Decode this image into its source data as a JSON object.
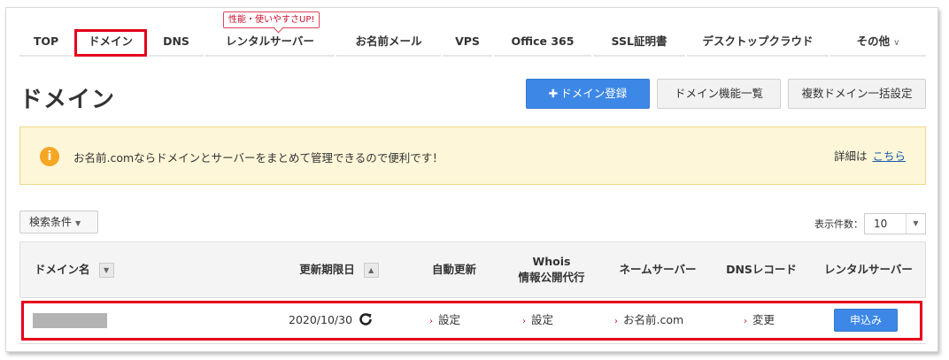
{
  "nav": {
    "items": [
      {
        "label": "TOP"
      },
      {
        "label": "ドメイン"
      },
      {
        "label": "DNS"
      },
      {
        "label": "レンタルサーバー"
      },
      {
        "label": "お名前メール"
      },
      {
        "label": "VPS"
      },
      {
        "label": "Office 365"
      },
      {
        "label": "SSL証明書"
      },
      {
        "label": "デスクトップクラウド"
      },
      {
        "label": "その他"
      }
    ],
    "selected_index": 1,
    "badge": "性能・使いやすさUP!"
  },
  "header": {
    "title": "ドメイン",
    "register_button": "ドメイン登録",
    "features_button": "ドメイン機能一覧",
    "bulk_button": "複数ドメイン一括設定"
  },
  "notice": {
    "icon": "i",
    "text": "お名前.comならドメインとサーバーをまとめて管理できるので便利です！",
    "detail_label": "詳細は",
    "detail_link": "こちら"
  },
  "filters": {
    "search_label": "検索条件",
    "count_label": "表示件数：",
    "count_value": "10"
  },
  "table": {
    "headers": {
      "domain": "ドメイン名",
      "expiry": "更新期限日",
      "auto_renew": "自動更新",
      "whois_line1": "Whois",
      "whois_line2": "情報公開代行",
      "nameserver": "ネームサーバー",
      "dns_record": "DNSレコード",
      "rental_server": "レンタルサーバー"
    },
    "rows": [
      {
        "domain": "",
        "expiry": "2020/10/30",
        "auto_renew": "設定",
        "whois": "設定",
        "nameserver": "お名前.com",
        "dns_record": "変更",
        "rental_server": "申込み"
      }
    ]
  },
  "colors": {
    "accent_red": "#e5001b",
    "primary_blue": "#3d88e6",
    "notice_bg": "#fdf6d8",
    "info_orange": "#f5a623"
  }
}
